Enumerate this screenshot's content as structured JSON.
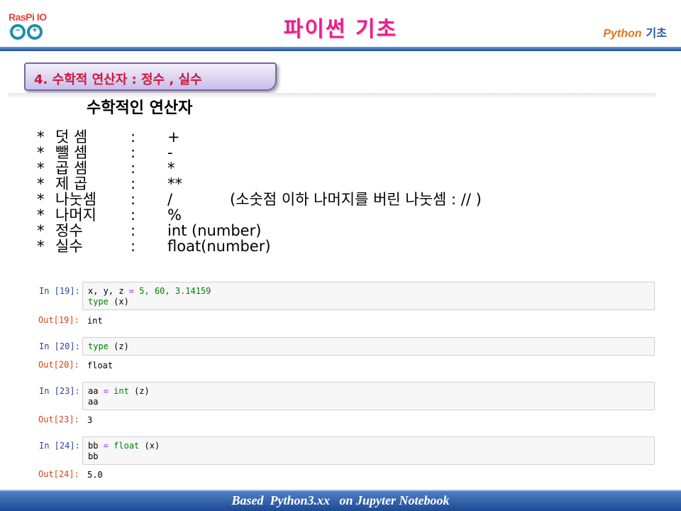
{
  "header": {
    "logo_text": "RasPi IO",
    "logo_minus": "−",
    "logo_plus": "+",
    "title": "파이썬 기초",
    "tag_en": "Python",
    "tag_ko": "기초"
  },
  "section": {
    "banner": "4. 수학적 연산자 :  정수 , 실수"
  },
  "markdown": {
    "heading": "수학적인 연산자",
    "operators": [
      {
        "bullet": "*",
        "name": "덧 셈",
        "colon": ":",
        "symbol": "+",
        "note": ""
      },
      {
        "bullet": "*",
        "name": "뺄 셈",
        "colon": ":",
        "symbol": "-",
        "note": ""
      },
      {
        "bullet": "*",
        "name": "곱 셈",
        "colon": ":",
        "symbol": "*",
        "note": ""
      },
      {
        "bullet": "*",
        "name": "제 곱",
        "colon": ":",
        "symbol": "**",
        "note": ""
      },
      {
        "bullet": "*",
        "name": "나눗셈",
        "colon": ":",
        "symbol": "/",
        "note": "(소숫점 이하 나머지를 버린 나눗셈 :  // )"
      },
      {
        "bullet": "*",
        "name": "나머지",
        "colon": ":",
        "symbol": "%",
        "note": ""
      },
      {
        "bullet": "*",
        "name": "정수",
        "colon": ":",
        "symbol": "int (number)",
        "note": ""
      },
      {
        "bullet": "*",
        "name": "실수",
        "colon": ":",
        "symbol": "float(number)",
        "note": ""
      }
    ]
  },
  "cells": [
    {
      "in_label": "In [19]:",
      "code_line1": {
        "vars": "x, y, z ",
        "eq": "=",
        "vals_sp": " ",
        "vals": "5, 60, 3.14159"
      },
      "code_line2": {
        "fn": "type",
        "arg": " (x)"
      },
      "out_label": "Out[19]:",
      "output": "int"
    },
    {
      "in_label": "In [20]:",
      "code_line1": {
        "fn": "type",
        "arg": " (z)"
      },
      "out_label": "Out[20]:",
      "output": "float"
    },
    {
      "in_label": "In [23]:",
      "code_line1": {
        "var": "aa ",
        "eq": "=",
        "sp": " ",
        "fn": "int",
        "arg": " (z)"
      },
      "code_line2": "aa",
      "out_label": "Out[23]:",
      "output": "3"
    },
    {
      "in_label": "In [24]:",
      "code_line1": {
        "var": "bb ",
        "eq": "=",
        "sp": " ",
        "fn": "float",
        "arg": " (x)"
      },
      "code_line2": "bb",
      "out_label": "Out[24]:",
      "output": "5.0"
    }
  ],
  "footer": {
    "text": "Based  Python3.xx   on Jupyter Notebook"
  },
  "colors": {
    "title": "#e81f8c",
    "banner_text": "#d0163e",
    "in_prompt": "#303f9f",
    "out_prompt": "#d84315",
    "footer_bg": "#1d4a93"
  }
}
